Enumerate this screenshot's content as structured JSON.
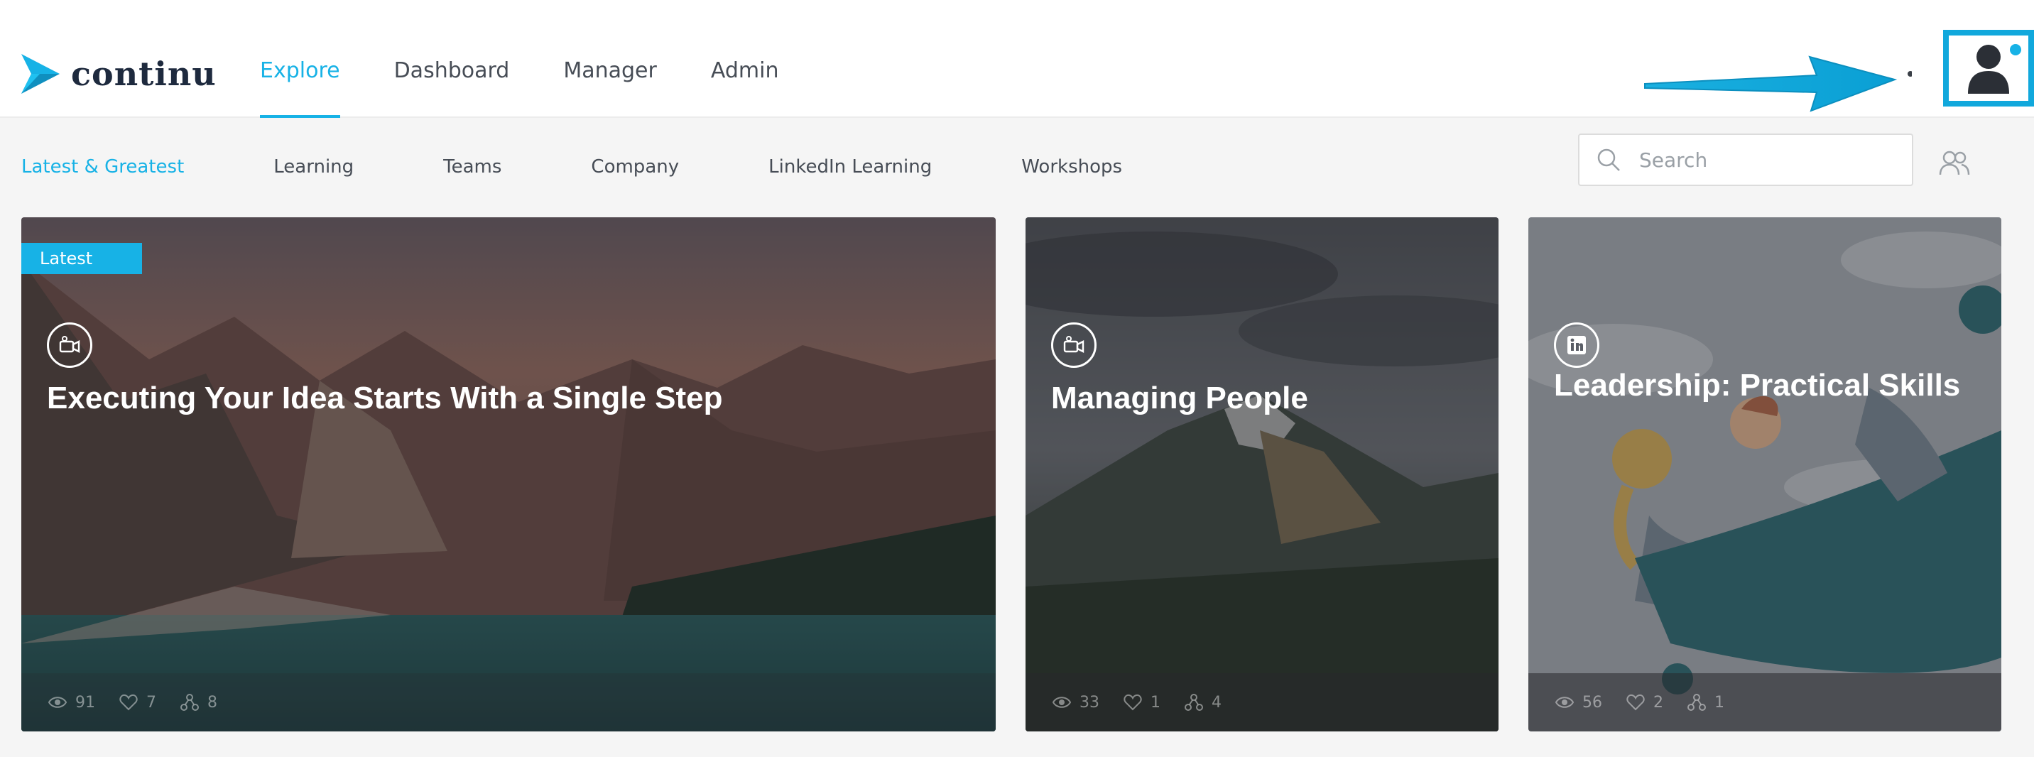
{
  "brand": {
    "name": "continu",
    "accent": "#17b2e6"
  },
  "main_nav": [
    {
      "label": "Explore",
      "active": true
    },
    {
      "label": "Dashboard",
      "active": false
    },
    {
      "label": "Manager",
      "active": false
    },
    {
      "label": "Admin",
      "active": false
    }
  ],
  "sub_nav": [
    {
      "label": "Latest & Greatest",
      "active": true
    },
    {
      "label": "Learning",
      "active": false
    },
    {
      "label": "Teams",
      "active": false
    },
    {
      "label": "Company",
      "active": false
    },
    {
      "label": "LinkedIn Learning",
      "active": false
    },
    {
      "label": "Workshops",
      "active": false
    }
  ],
  "search": {
    "placeholder": "Search",
    "value": ""
  },
  "cards": [
    {
      "badge": "Latest",
      "type_icon": "video-icon",
      "title": "Executing Your Idea Starts With a Single Step",
      "views": "91",
      "likes": "7",
      "shares": "8"
    },
    {
      "type_icon": "video-icon",
      "title": "Managing People",
      "views": "33",
      "likes": "1",
      "shares": "4"
    },
    {
      "type_icon": "linkedin-icon",
      "title": "Leadership: Practical Skills",
      "views": "56",
      "likes": "2",
      "shares": "1"
    }
  ]
}
